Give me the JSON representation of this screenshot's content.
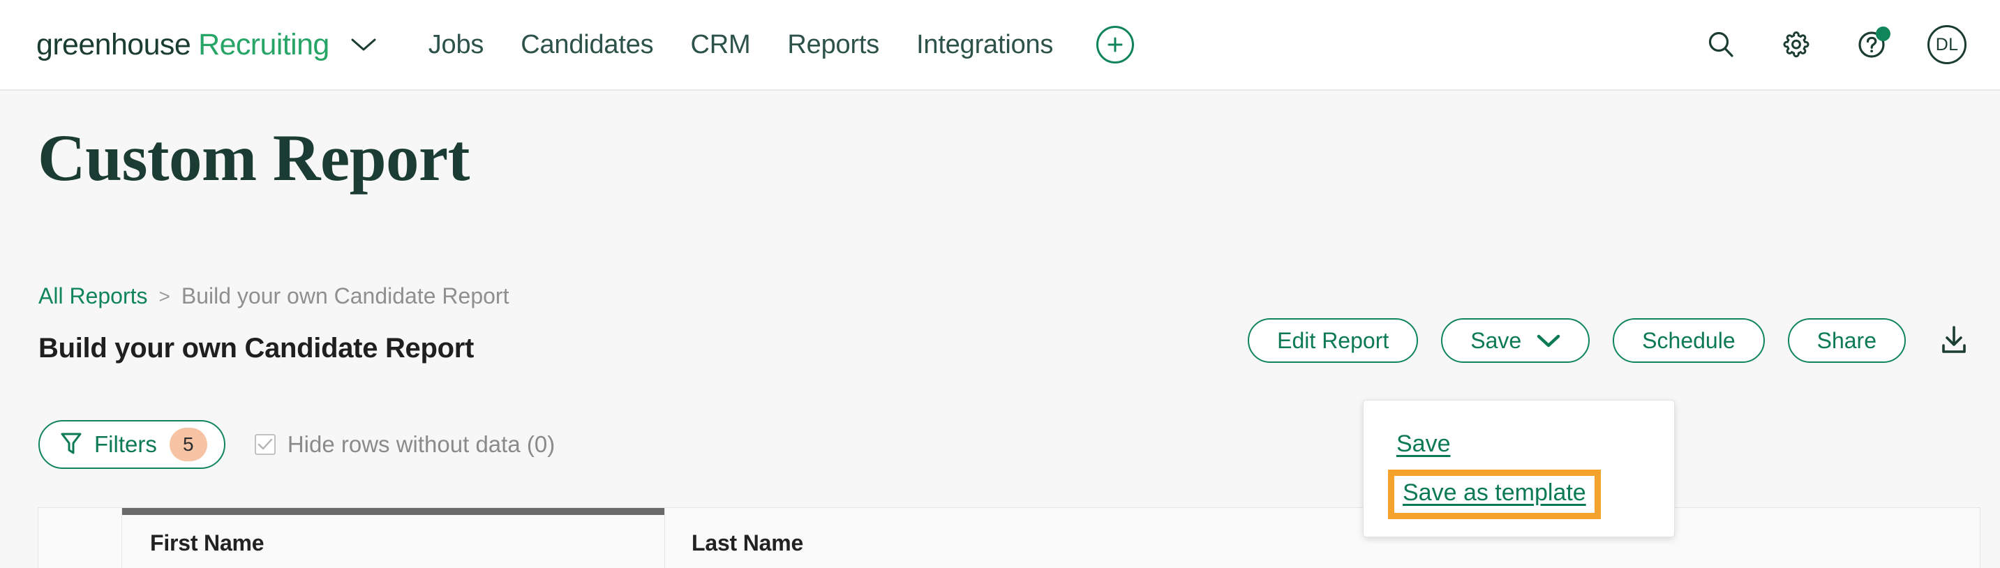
{
  "nav": {
    "brand_primary": "greenhouse",
    "brand_secondary": "Recruiting",
    "links": [
      {
        "label": "Jobs"
      },
      {
        "label": "Candidates"
      },
      {
        "label": "CRM"
      },
      {
        "label": "Reports"
      },
      {
        "label": "Integrations"
      }
    ],
    "add_icon": "plus-circle-icon",
    "search_icon": "search-icon",
    "settings_icon": "gear-icon",
    "help_icon": "question-mark-icon",
    "avatar_initials": "DL"
  },
  "header": {
    "title": "Custom Report"
  },
  "breadcrumb": {
    "root": "All Reports",
    "separator": ">",
    "current": "Build your own Candidate Report"
  },
  "report": {
    "subtitle": "Build your own Candidate Report"
  },
  "actions": {
    "edit_report": "Edit Report",
    "save": "Save",
    "schedule": "Schedule",
    "share": "Share",
    "download_icon": "download-icon"
  },
  "save_menu": {
    "open": true,
    "items": [
      {
        "label": "Save",
        "highlighted": false
      },
      {
        "label": "Save as template",
        "highlighted": true
      }
    ],
    "highlight_color": "#f5a22d"
  },
  "filters": {
    "label": "Filters",
    "count": "5",
    "icon": "funnel-icon",
    "badge_color": "#f6c4a5",
    "hide_rows_label": "Hide rows without data (0)",
    "hide_rows_checked": true
  },
  "table": {
    "columns": [
      {
        "label": "First Name"
      },
      {
        "label": "Last Name"
      }
    ]
  },
  "colors": {
    "brand_dark_green": "#1b3c32",
    "brand_green": "#11855a",
    "link_green": "#0c7a52",
    "accent_orange": "#f5a22d",
    "page_background": "#f7f7f7"
  }
}
